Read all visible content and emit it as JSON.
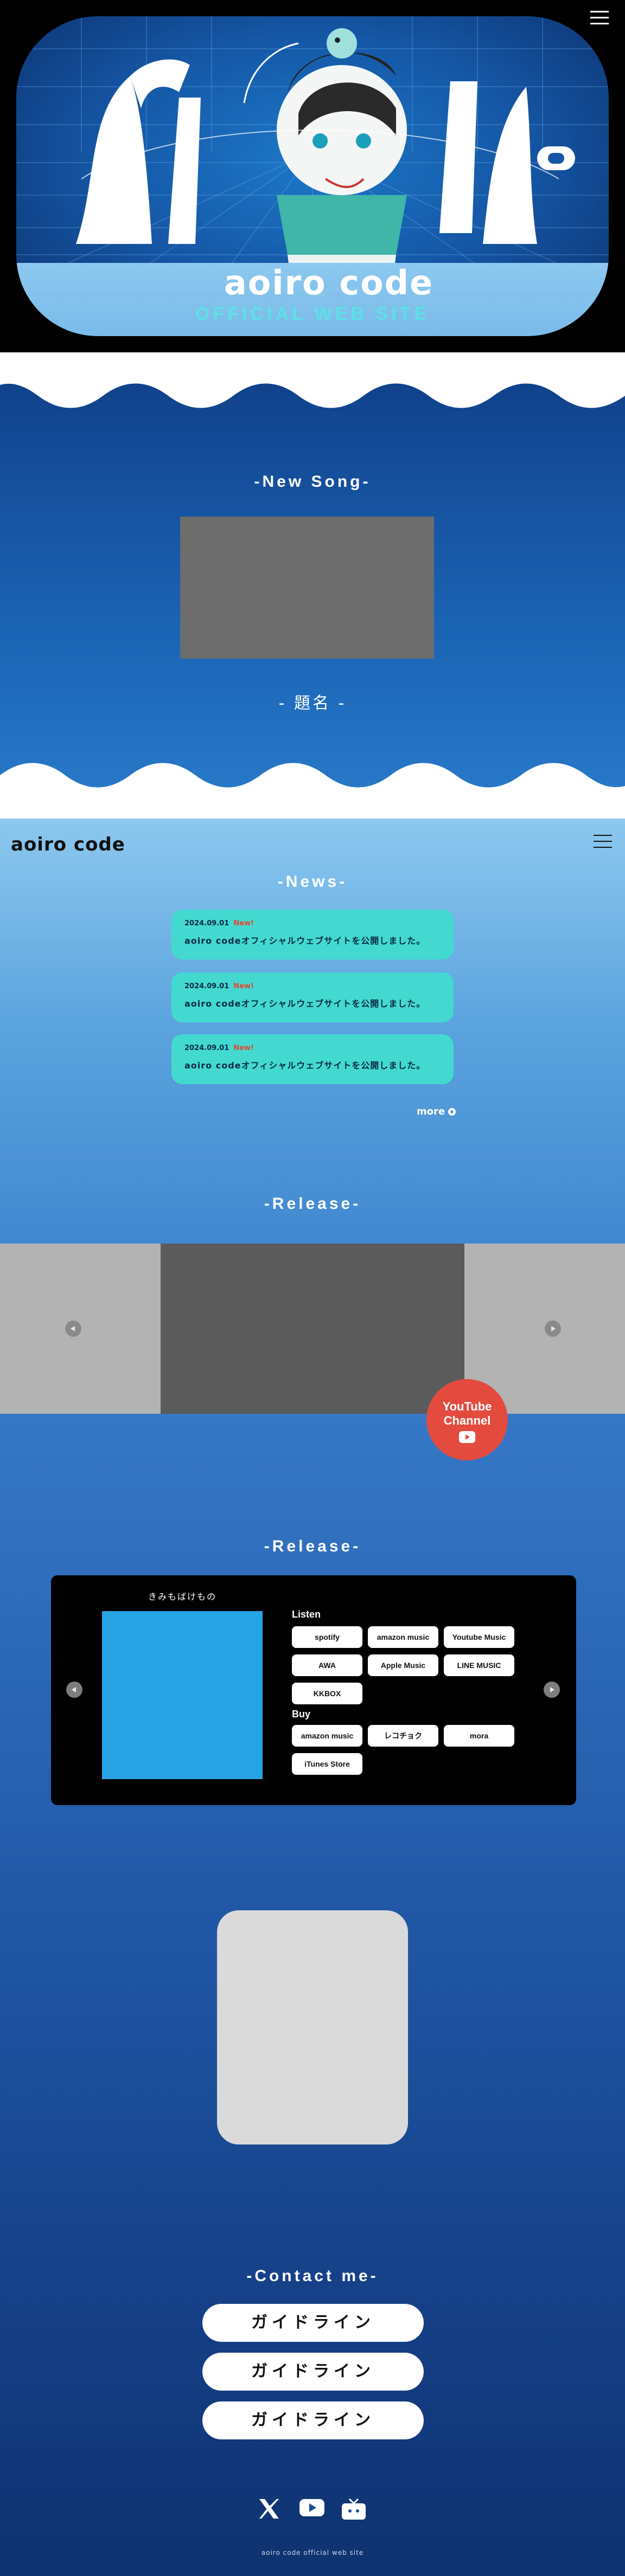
{
  "hero": {
    "logo": "aoiro code",
    "subtitle": "OFFICIAL WEB SITE",
    "accent": "#5de0e6"
  },
  "new_song": {
    "title": "-New Song-",
    "song_name": "- 題名 -"
  },
  "header": {
    "logo": "aoiro code"
  },
  "news": {
    "title": "-News-",
    "items": [
      {
        "date": "2024.09.01",
        "badge": "New!",
        "text": "aoiro codeオフィシャルウェブサイトを公開しました。"
      },
      {
        "date": "2024.09.01",
        "badge": "New!",
        "text": "aoiro codeオフィシャルウェブサイトを公開しました。"
      },
      {
        "date": "2024.09.01",
        "badge": "New!",
        "text": "aoiro codeオフィシャルウェブサイトを公開しました。"
      }
    ],
    "more": "more"
  },
  "release_video": {
    "title": "-Release-"
  },
  "youtube": {
    "line1": "YouTube",
    "line2": "Channel",
    "color": "#e34b3f"
  },
  "release": {
    "title": "-Release-",
    "album_title": "きみもばけもの",
    "listen_label": "Listen",
    "listen": [
      "spotify",
      "amazon music",
      "Youtube Music",
      "AWA",
      "Apple Music",
      "LINE MUSIC",
      "KKBOX"
    ],
    "buy_label": "Buy",
    "buy": [
      "amazon music",
      "レコチョク",
      "mora",
      "iTunes Store"
    ]
  },
  "contact": {
    "title": "-Contact me-",
    "buttons": [
      "ガイドライン",
      "ガイドライン",
      "ガイドライン"
    ]
  },
  "footer": {
    "text": "aoiro code official web site"
  }
}
